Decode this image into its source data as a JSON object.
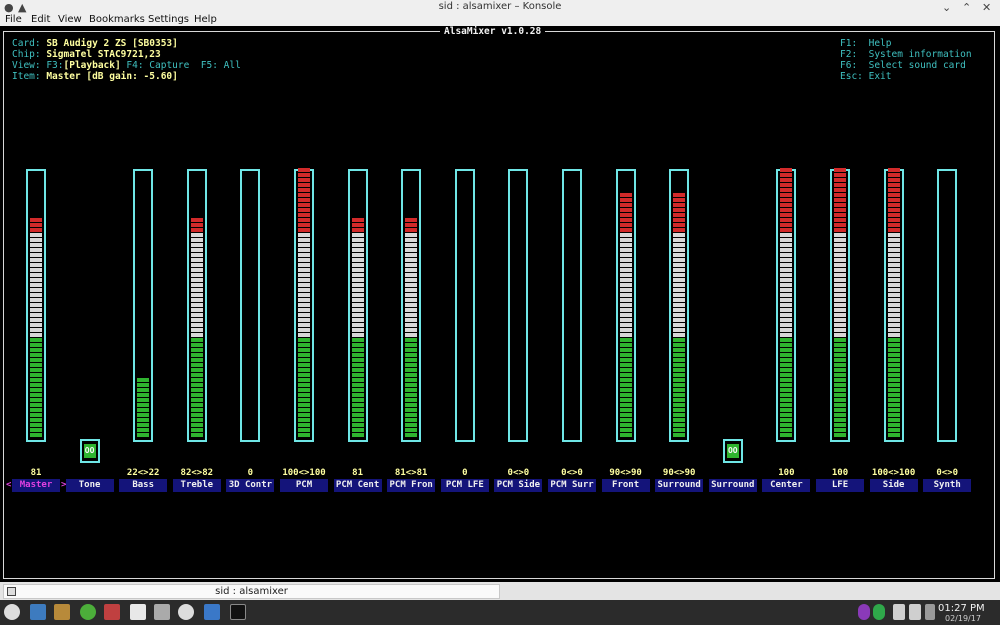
{
  "window": {
    "title": "sid : alsamixer – Konsole",
    "menu": [
      "File",
      "Edit",
      "View",
      "Bookmarks",
      "Settings",
      "Help"
    ]
  },
  "mixer": {
    "title": "AlsaMixer v1.0.28",
    "info": [
      {
        "key": "Card: ",
        "value": "SB Audigy 2 ZS [SB0353]"
      },
      {
        "key": "Chip: ",
        "value": "SigmaTel STAC9721,23"
      },
      {
        "key": "View: ",
        "parts": [
          "F3:",
          "[Playback]",
          " F4: Capture  F5: All"
        ]
      },
      {
        "key": "Item: ",
        "value": "Master [dB gain: -5.60]"
      }
    ],
    "help": [
      "F1:  Help",
      "F2:  System information",
      "F6:  Select sound card",
      "Esc: Exit"
    ],
    "channels": [
      {
        "name": "Master",
        "volume": "81",
        "level": 81,
        "type": "bar",
        "active": true
      },
      {
        "name": "Tone",
        "volume": "",
        "type": "switch",
        "switch": "OO"
      },
      {
        "name": "Bass",
        "volume": "22<>22",
        "level": 22,
        "type": "bar"
      },
      {
        "name": "Treble",
        "volume": "82<>82",
        "level": 82,
        "type": "bar"
      },
      {
        "name": "3D Contr",
        "volume": "0",
        "level": 0,
        "type": "bar"
      },
      {
        "name": "PCM",
        "volume": "100<>100",
        "level": 100,
        "type": "bar"
      },
      {
        "name": "PCM Cent",
        "volume": "81",
        "level": 81,
        "type": "bar"
      },
      {
        "name": "PCM Fron",
        "volume": "81<>81",
        "level": 81,
        "type": "bar"
      },
      {
        "name": "PCM LFE",
        "volume": "0",
        "level": 0,
        "type": "bar"
      },
      {
        "name": "PCM Side",
        "volume": "0<>0",
        "level": 0,
        "type": "bar"
      },
      {
        "name": "PCM Surr",
        "volume": "0<>0",
        "level": 0,
        "type": "bar"
      },
      {
        "name": "Front",
        "volume": "90<>90",
        "level": 90,
        "type": "bar"
      },
      {
        "name": "Surround",
        "volume": "90<>90",
        "level": 90,
        "type": "bar"
      },
      {
        "name": "Surround",
        "volume": "",
        "type": "switch",
        "switch": "OO"
      },
      {
        "name": "Center",
        "volume": "100",
        "level": 100,
        "type": "bar"
      },
      {
        "name": "LFE",
        "volume": "100",
        "level": 100,
        "type": "bar"
      },
      {
        "name": "Side",
        "volume": "100<>100",
        "level": 100,
        "type": "bar"
      },
      {
        "name": "Synth",
        "volume": "0<>0",
        "level": 0,
        "type": "bar"
      }
    ],
    "active_left_arrow": "<",
    "active_right_arrow": ">"
  },
  "tab": {
    "label": "sid : alsamixer"
  },
  "clock": {
    "time": "01:27 PM",
    "date": "02/19/17"
  },
  "colors": {
    "green": "#2fb42f",
    "white": "#d8d8d8",
    "red": "#d22a2a",
    "frame": "#6fe6e6"
  }
}
